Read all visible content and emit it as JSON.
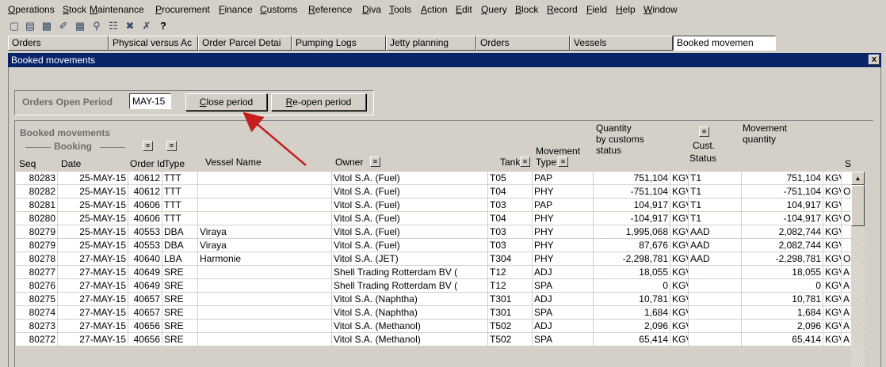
{
  "menu": [
    "Operations",
    "Stock",
    "Maintenance",
    "Procurement",
    "Finance",
    "Customs",
    "Reference",
    "Diva",
    "Tools",
    "Action",
    "Edit",
    "Query",
    "Block",
    "Record",
    "Field",
    "Help",
    "Window"
  ],
  "toolbar_icons": [
    "save-icon",
    "new-icon",
    "print-icon",
    "edit-icon",
    "copy-icon",
    "search-icon",
    "filter-icon",
    "delete-icon",
    "clear-icon",
    "help-icon"
  ],
  "tabs": [
    "Orders",
    "Physical versus Ac",
    "Order Parcel Detai",
    "Pumping Logs",
    "Jetty planning",
    "Orders",
    "Vessels",
    "Booked movemen"
  ],
  "window": {
    "title": "Booked movements",
    "close": "x"
  },
  "period": {
    "label": "Orders Open Period",
    "value": "MAY-15",
    "close_btn": "Close period",
    "reopen_btn": "Re-open period"
  },
  "group": {
    "title": "Booked movements",
    "booking": "Booking"
  },
  "headers": {
    "seq": "Seq",
    "date": "Date",
    "order_id": "Order Id",
    "type": "Type",
    "vessel": "Vessel Name",
    "owner": "Owner",
    "tank": "Tank",
    "movement_l1": "Movement",
    "movement_l2": "Type",
    "qty_l1": "Quantity",
    "qty_l2": "by customs",
    "qty_l3": "status",
    "cust_l1": "Cust.",
    "cust_l2": "Status",
    "mq_l1": "Movement",
    "mq_l2": "quantity",
    "s": "S"
  },
  "rows": [
    {
      "seq": "80283",
      "date": "25-MAY-15",
      "order": "40612",
      "type": "TTT",
      "vessel": "",
      "owner": "Vitol S.A. (Fuel)",
      "tank": "T05",
      "mtype": "PAP",
      "qty": "751,104",
      "qunit": "KGV",
      "cust": "T1",
      "mq": "751,104",
      "munit": "KGV",
      "s": ""
    },
    {
      "seq": "80282",
      "date": "25-MAY-15",
      "order": "40612",
      "type": "TTT",
      "vessel": "",
      "owner": "Vitol S.A. (Fuel)",
      "tank": "T04",
      "mtype": "PHY",
      "qty": "-751,104",
      "qunit": "KGV",
      "cust": "T1",
      "mq": "-751,104",
      "munit": "KGV",
      "s": "O"
    },
    {
      "seq": "80281",
      "date": "25-MAY-15",
      "order": "40606",
      "type": "TTT",
      "vessel": "",
      "owner": "Vitol S.A. (Fuel)",
      "tank": "T03",
      "mtype": "PAP",
      "qty": "104,917",
      "qunit": "KGV",
      "cust": "T1",
      "mq": "104,917",
      "munit": "KGV",
      "s": ""
    },
    {
      "seq": "80280",
      "date": "25-MAY-15",
      "order": "40606",
      "type": "TTT",
      "vessel": "",
      "owner": "Vitol S.A. (Fuel)",
      "tank": "T04",
      "mtype": "PHY",
      "qty": "-104,917",
      "qunit": "KGV",
      "cust": "T1",
      "mq": "-104,917",
      "munit": "KGV",
      "s": "O"
    },
    {
      "seq": "80279",
      "date": "25-MAY-15",
      "order": "40553",
      "type": "DBA",
      "vessel": "Viraya",
      "owner": "Vitol S.A. (Fuel)",
      "tank": "T03",
      "mtype": "PHY",
      "qty": "1,995,068",
      "qunit": "KGV",
      "cust": "AAD",
      "mq": "2,082,744",
      "munit": "KGV",
      "s": ""
    },
    {
      "seq": "80279",
      "date": "25-MAY-15",
      "order": "40553",
      "type": "DBA",
      "vessel": "Viraya",
      "owner": "Vitol S.A. (Fuel)",
      "tank": "T03",
      "mtype": "PHY",
      "qty": "87,676",
      "qunit": "KGV",
      "cust": "AAD",
      "mq": "2,082,744",
      "munit": "KGV",
      "s": ""
    },
    {
      "seq": "80278",
      "date": "27-MAY-15",
      "order": "40640",
      "type": "LBA",
      "vessel": "Harmonie",
      "owner": "Vitol S.A. (JET)",
      "tank": "T304",
      "mtype": "PHY",
      "qty": "-2,298,781",
      "qunit": "KGV",
      "cust": "AAD",
      "mq": "-2,298,781",
      "munit": "KGV",
      "s": "O"
    },
    {
      "seq": "80277",
      "date": "27-MAY-15",
      "order": "40649",
      "type": "SRE",
      "vessel": "",
      "owner": "Shell Trading Rotterdam BV (",
      "tank": "T12",
      "mtype": "ADJ",
      "qty": "18,055",
      "qunit": "KGV",
      "cust": "",
      "mq": "18,055",
      "munit": "KGV",
      "s": "A"
    },
    {
      "seq": "80276",
      "date": "27-MAY-15",
      "order": "40649",
      "type": "SRE",
      "vessel": "",
      "owner": "Shell Trading Rotterdam BV (",
      "tank": "T12",
      "mtype": "SPA",
      "qty": "0",
      "qunit": "KGV",
      "cust": "",
      "mq": "0",
      "munit": "KGV",
      "s": "A"
    },
    {
      "seq": "80275",
      "date": "27-MAY-15",
      "order": "40657",
      "type": "SRE",
      "vessel": "",
      "owner": "Vitol S.A. (Naphtha)",
      "tank": "T301",
      "mtype": "ADJ",
      "qty": "10,781",
      "qunit": "KGV",
      "cust": "",
      "mq": "10,781",
      "munit": "KGV",
      "s": "A"
    },
    {
      "seq": "80274",
      "date": "27-MAY-15",
      "order": "40657",
      "type": "SRE",
      "vessel": "",
      "owner": "Vitol S.A. (Naphtha)",
      "tank": "T301",
      "mtype": "SPA",
      "qty": "1,684",
      "qunit": "KGV",
      "cust": "",
      "mq": "1,684",
      "munit": "KGV",
      "s": "A"
    },
    {
      "seq": "80273",
      "date": "27-MAY-15",
      "order": "40656",
      "type": "SRE",
      "vessel": "",
      "owner": "Vitol S.A. (Methanol)",
      "tank": "T502",
      "mtype": "ADJ",
      "qty": "2,096",
      "qunit": "KGV",
      "cust": "",
      "mq": "2,096",
      "munit": "KGV",
      "s": "A"
    },
    {
      "seq": "80272",
      "date": "27-MAY-15",
      "order": "40656",
      "type": "SRE",
      "vessel": "",
      "owner": "Vitol S.A. (Methanol)",
      "tank": "T502",
      "mtype": "SPA",
      "qty": "65,414",
      "qunit": "KGV",
      "cust": "",
      "mq": "65,414",
      "munit": "KGV",
      "s": "A"
    }
  ],
  "colors": {
    "title_bar": "#0a246a",
    "face": "#d4d0c8",
    "annotation_arrow": "#c41e1e"
  }
}
